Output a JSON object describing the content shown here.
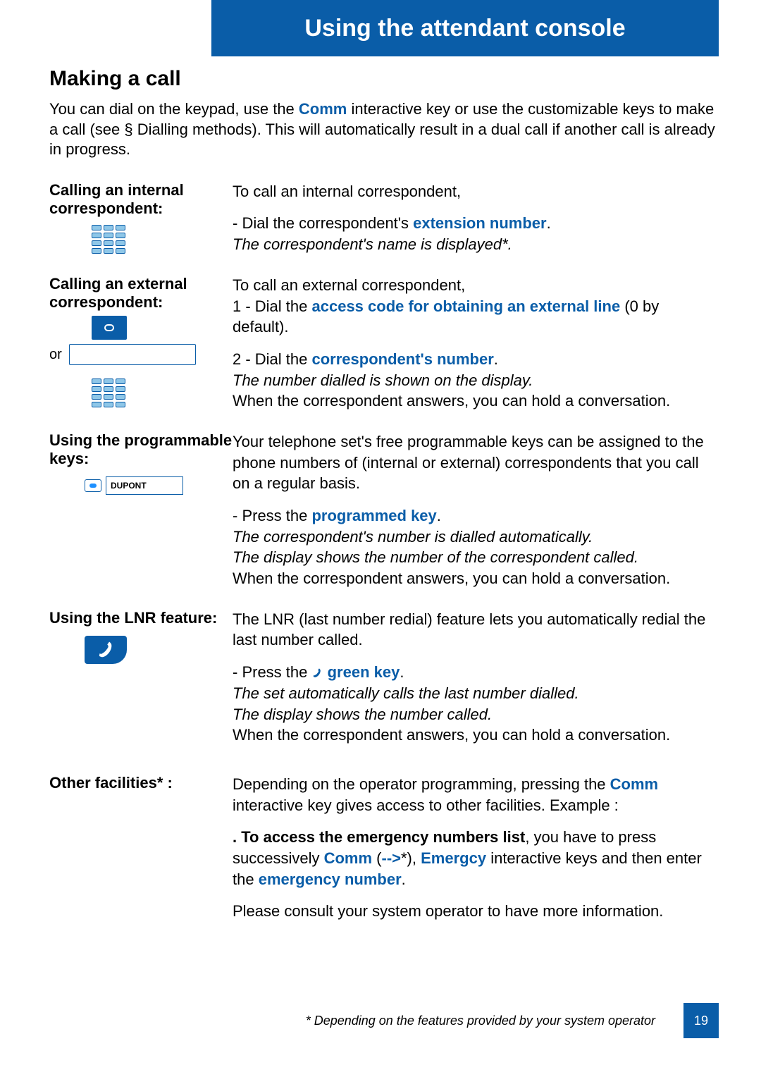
{
  "header": {
    "title": "Using the attendant console"
  },
  "section": {
    "title": "Making a call"
  },
  "intro": {
    "prefix": "You can dial on the keypad, use the ",
    "comm": "Comm",
    "suffix": " interactive key or use the customizable keys to make a call (see § Dialling methods). This will automatically result in a dual call if another call is already in progress."
  },
  "s1": {
    "heading": "Calling an internal correspondent:",
    "lead": "To call an internal correspondent,",
    "b1_pre": "- Dial the correspondent's ",
    "b1_blue": "extension number",
    "b1_post": ".",
    "it": "The correspondent's name is displayed*."
  },
  "s2": {
    "heading": "Calling an external correspondent:",
    "or": "or",
    "lead": "To call an external correspondent,",
    "l1_pre": "1 - Dial the ",
    "l1_blue": "access code for obtaining an external line",
    "l1_post": " (0 by default).",
    "l2_pre": "2 - Dial the ",
    "l2_blue": "correspondent's number",
    "l2_post": ".",
    "it": "The number dialled is shown on the display.",
    "after": "When the correspondent answers, you can hold a conversation."
  },
  "s3": {
    "heading": "Using the programmable keys:",
    "key_label": "DUPONT",
    "lead": "Your telephone set's free programmable keys can be assigned to the phone numbers of (internal or external) correspondents that you call on a regular basis.",
    "b_pre": "- Press the ",
    "b_blue": "programmed key",
    "b_post": ".",
    "it1": "The correspondent's number is dialled automatically.",
    "it2": "The display shows the number of the correspondent called.",
    "after": "When the correspondent answers, you can hold a conversation."
  },
  "s4": {
    "heading": "Using the LNR feature:",
    "lead": "The LNR (last number redial) feature lets you automatically redial the last number called.",
    "b_pre": "- Press the ",
    "b_blue": " green key",
    "b_post": ".",
    "it1": "The set automatically calls the last number dialled.",
    "it2": "The display shows the number called.",
    "after": "When the correspondent answers, you can hold a conversation."
  },
  "s5": {
    "heading": "Other facilities* :",
    "p1_pre": "Depending on the operator programming, pressing the ",
    "p1_comm": "Comm",
    "p1_post": " interactive key gives access to other facilities. Example :",
    "p2_bold": ". To access the emergency numbers list",
    "p2_mid1": ", you have to press successively ",
    "p2_comm": "Comm",
    "p2_paren1": " (",
    "p2_arrow": "-->",
    "p2_star": "*), ",
    "p2_emerg": "Emergcy",
    "p2_mid2": " interactive keys and then enter the ",
    "p2_emnum": "emergency number",
    "p2_post": ".",
    "p3": "Please consult your system operator to have more information."
  },
  "footnote": "* Depending on the features provided by your system operator",
  "page": "19"
}
